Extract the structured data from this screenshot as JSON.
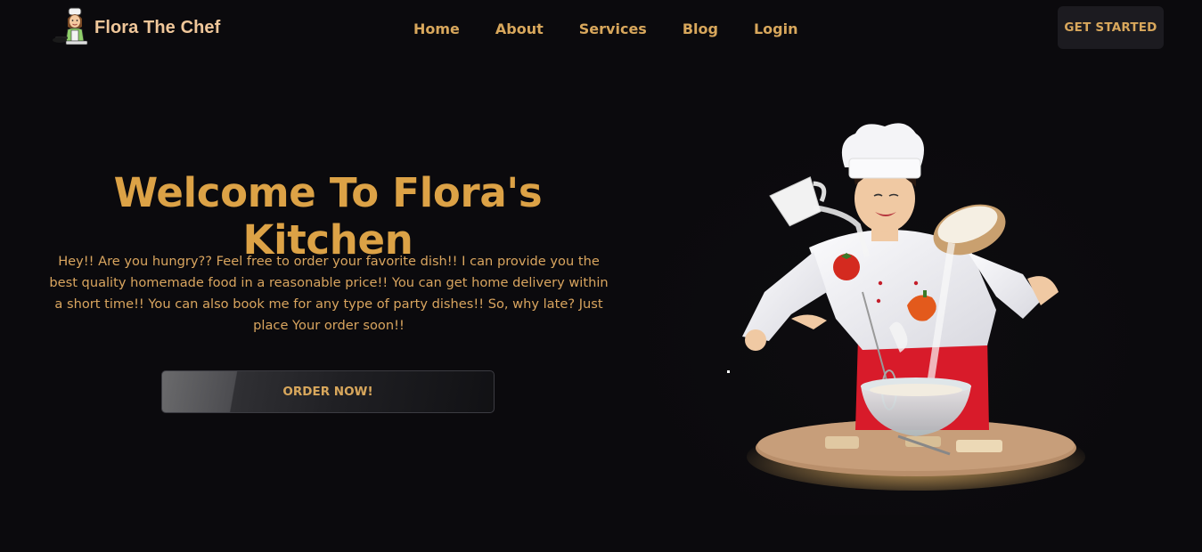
{
  "brand": {
    "name": "Flora The Chef",
    "logo_icon": "chef-avatar-icon"
  },
  "nav": {
    "links": [
      "Home",
      "About",
      "Services",
      "Blog",
      "Login"
    ]
  },
  "header": {
    "cta_label": "GET STARTED"
  },
  "hero": {
    "title": "Welcome To Flora's Kitchen",
    "description": "Hey!! Are you hungry?? Feel free to order your favorite dish!! I can provide you the best quality homemade food in a reasonable price!! You can get home delivery within a short time!! You can also book me for any type of party dishes!! So, why late? Just place Your order soon!!",
    "order_button": "ORDER NOW!",
    "image_icon": "chef-cooking-illustration"
  },
  "colors": {
    "background": "#0b0a0d",
    "accent": "#dca246",
    "nav_text": "#d8a75c",
    "brand_text": "#f0c79a",
    "button_dark": "#1c1b20"
  }
}
